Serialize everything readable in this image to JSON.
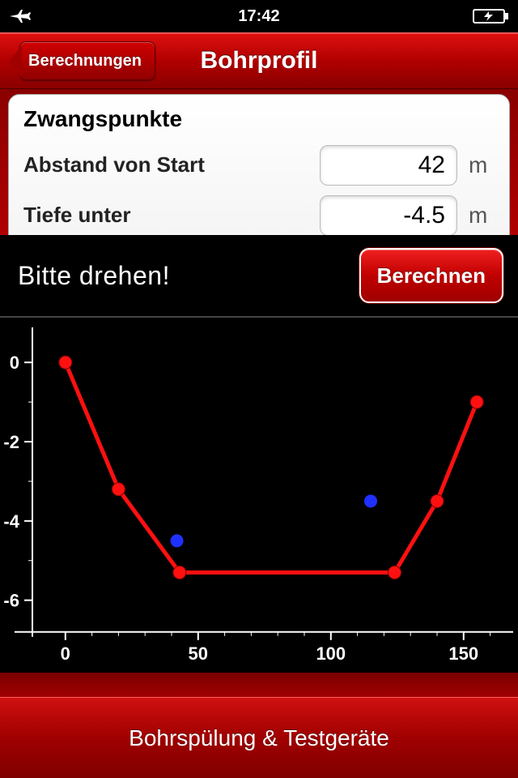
{
  "status": {
    "time": "17:42"
  },
  "nav": {
    "back_label": "Berechnungen",
    "title": "Bohrprofil"
  },
  "card": {
    "heading": "Zwangspunkte",
    "field1": {
      "label": "Abstand von Start",
      "value": "42",
      "unit": "m"
    },
    "field2": {
      "label": "Tiefe unter",
      "value": "-4.5",
      "unit": "m"
    }
  },
  "action": {
    "rotate_hint": "Bitte drehen!",
    "compute_label": "Berechnen"
  },
  "footer": {
    "label": "Bohrspülung & Testgeräte"
  },
  "chart_data": {
    "type": "line",
    "x": [
      0,
      20,
      43,
      124,
      140,
      155
    ],
    "y": [
      0,
      -3.2,
      -5.3,
      -5.3,
      -3.5,
      -1.0
    ],
    "markers": [
      {
        "x": 42,
        "y": -4.5
      },
      {
        "x": 115,
        "y": -3.5
      }
    ],
    "xlim": [
      -10,
      165
    ],
    "ylim": [
      -6.8,
      0.8
    ],
    "xticks": [
      0,
      50,
      100,
      150
    ],
    "yticks": [
      0,
      -2,
      -4,
      -6
    ],
    "line_color": "#ff1010",
    "marker_color": "#2030ff",
    "axis_color": "#ffffff",
    "title": "",
    "xlabel": "",
    "ylabel": ""
  }
}
